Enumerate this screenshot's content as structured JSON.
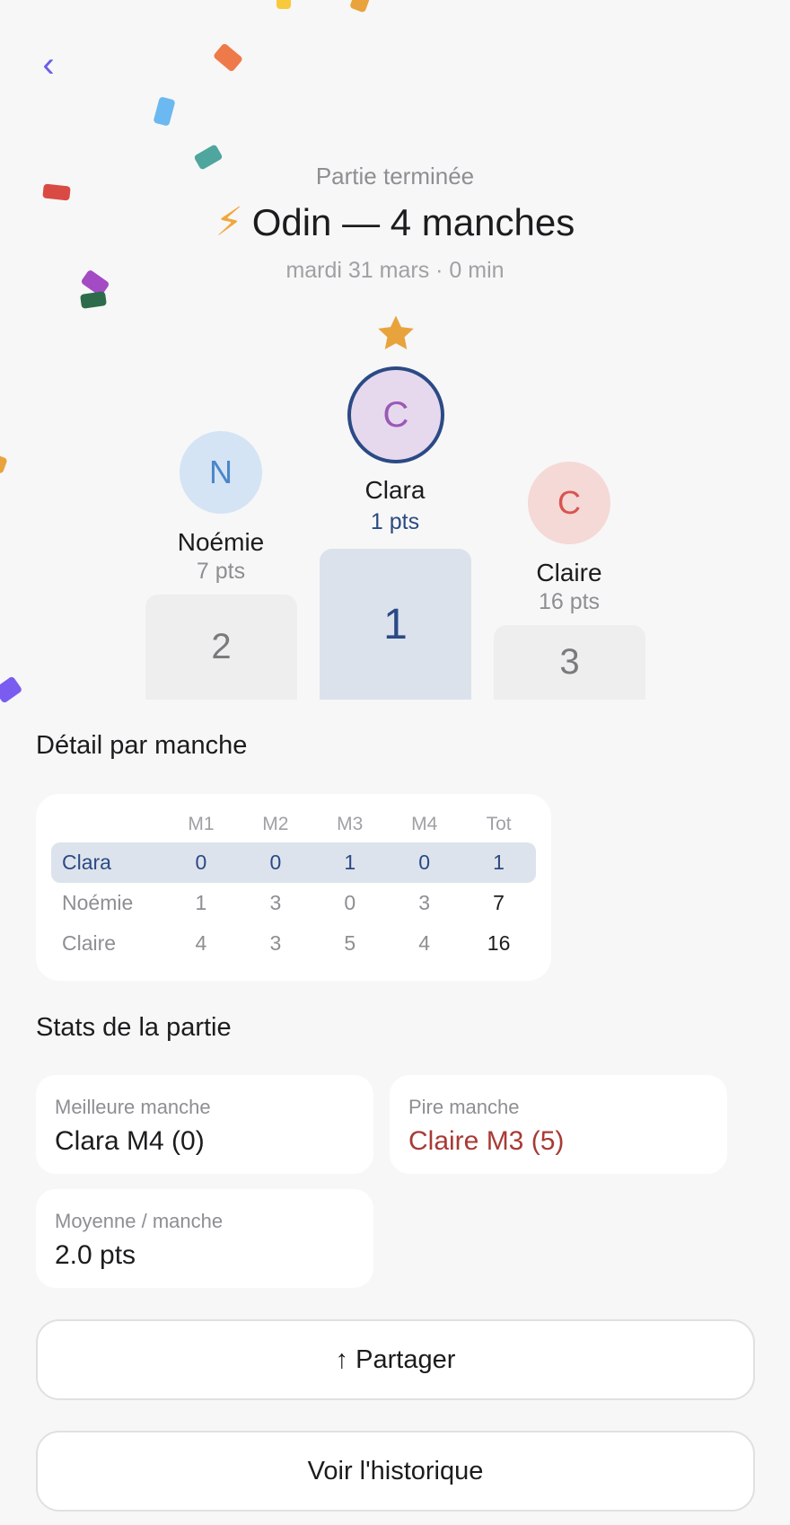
{
  "nav": {
    "back_icon": "‹"
  },
  "header": {
    "subtitle": "Partie terminée",
    "title_icon": "⚡",
    "title": "Odin — 4 manches",
    "meta": "mardi 31 mars · 0 min"
  },
  "podium": {
    "first": {
      "initial": "C",
      "name": "Clara",
      "pts": "1 pts",
      "rank": "1"
    },
    "second": {
      "initial": "N",
      "name": "Noémie",
      "pts": "7 pts",
      "rank": "2"
    },
    "third": {
      "initial": "C",
      "name": "Claire",
      "pts": "16 pts",
      "rank": "3"
    }
  },
  "detail": {
    "title": "Détail par manche",
    "headers": [
      "",
      "M1",
      "M2",
      "M3",
      "M4",
      "Tot"
    ],
    "rows": [
      [
        "Clara",
        "0",
        "0",
        "1",
        "0",
        "1"
      ],
      [
        "Noémie",
        "1",
        "3",
        "0",
        "3",
        "7"
      ],
      [
        "Claire",
        "4",
        "3",
        "5",
        "4",
        "16"
      ]
    ]
  },
  "stats": {
    "title": "Stats de la partie",
    "best_label": "Meilleure manche",
    "best_value": "Clara M4 (0)",
    "worst_label": "Pire manche",
    "worst_value": "Claire M3 (5)",
    "avg_label": "Moyenne / manche",
    "avg_value": "2.0 pts"
  },
  "actions": {
    "share": "↑ Partager",
    "history": "Voir l'historique"
  },
  "colors": {
    "accent": "#6a5cf0",
    "winner": "#2b4a85",
    "bad": "#a83a34",
    "star": "#e8a33d"
  }
}
